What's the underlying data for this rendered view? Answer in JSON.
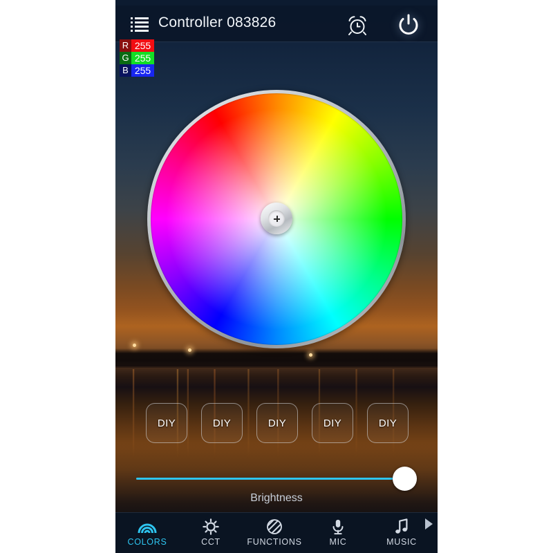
{
  "status_bar": {
    "text": ""
  },
  "header": {
    "title": "Controller 083826",
    "menu_icon": "list-icon",
    "alarm_icon": "alarm-clock-icon",
    "power_icon": "power-icon"
  },
  "rgb_readout": {
    "rows": [
      {
        "key": "R",
        "value": "255",
        "key_color": "#8a0f10",
        "value_color": "#f20d12"
      },
      {
        "key": "G",
        "value": "255",
        "key_color": "#0a6b12",
        "value_color": "#14de25"
      },
      {
        "key": "B",
        "value": "255",
        "key_color": "#09125e",
        "value_color": "#1826f0"
      }
    ]
  },
  "color_wheel": {
    "name": "hsv-color-wheel",
    "selector_icon": "crosshair-icon",
    "selected_position": "center",
    "selected_color": "#ffffff"
  },
  "presets": {
    "buttons": [
      {
        "label": "DIY"
      },
      {
        "label": "DIY"
      },
      {
        "label": "DIY"
      },
      {
        "label": "DIY"
      },
      {
        "label": "DIY"
      }
    ]
  },
  "brightness": {
    "label": "Brightness",
    "value": 100,
    "min": 0,
    "max": 100,
    "accent_color": "#2ec5f0"
  },
  "tabs": {
    "active": "COLORS",
    "accent_color": "#2ec5f0",
    "more_icon": "chevron-right-icon",
    "items": [
      {
        "label": "COLORS",
        "icon": "rainbow-icon"
      },
      {
        "label": "CCT",
        "icon": "sun-icon"
      },
      {
        "label": "FUNCTIONS",
        "icon": "striped-circle-icon"
      },
      {
        "label": "MIC",
        "icon": "microphone-icon"
      },
      {
        "label": "MUSIC",
        "icon": "music-note-icon"
      }
    ]
  }
}
